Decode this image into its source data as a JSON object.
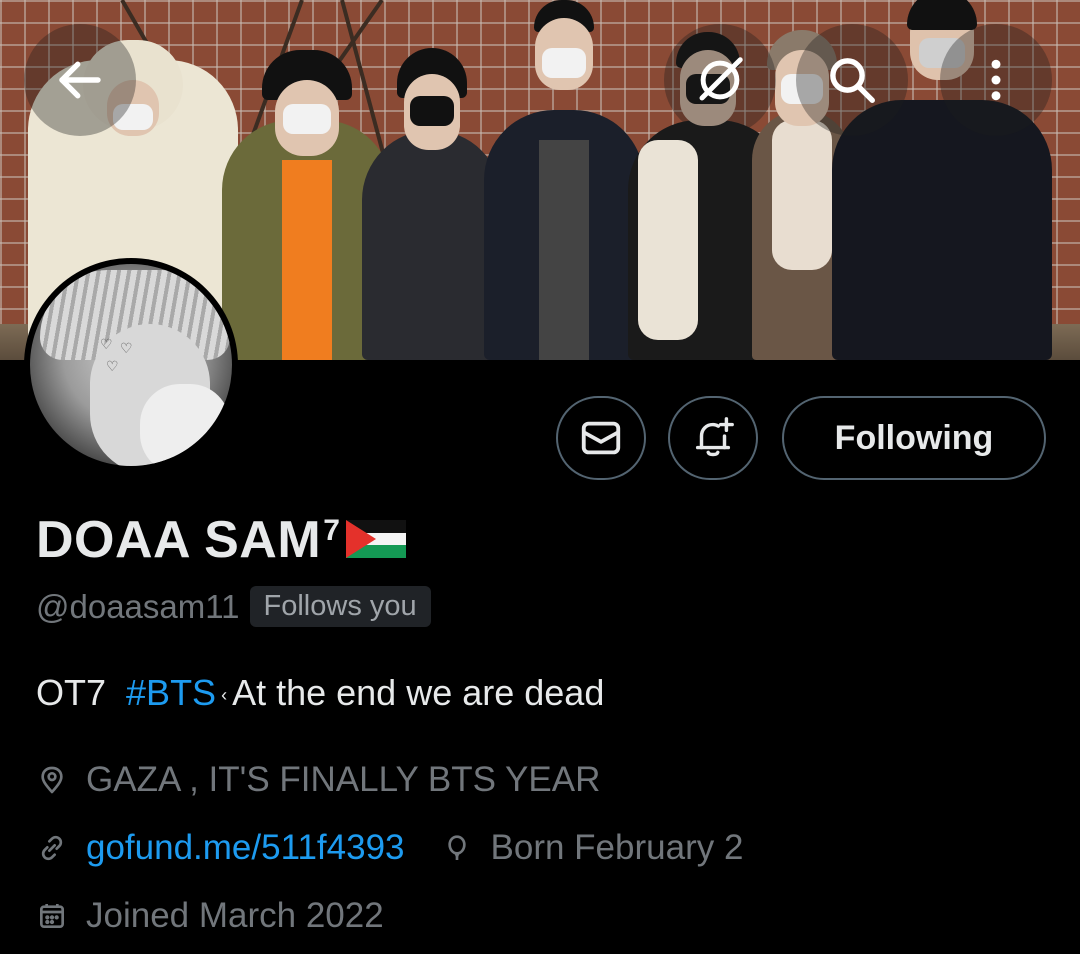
{
  "header": {
    "back_icon": "arrow-left-icon",
    "grok_icon": "grok-icon",
    "search_icon": "search-icon",
    "more_icon": "more-vertical-icon"
  },
  "actions": {
    "message_icon": "envelope-icon",
    "notify_icon": "bell-plus-icon",
    "following_label": "Following"
  },
  "profile": {
    "name": "DOAA SAM",
    "name_sup": "7",
    "handle": "@doaasam11",
    "follows_you": "Follows you",
    "bio_prefix": "OT7  ",
    "bio_hashtag": "#BTS",
    "bio_sep": " ‹ ",
    "bio_suffix": "At the end we are dead",
    "location": "GAZA , IT'S FINALLY BTS YEAR",
    "website": "gofund.me/511f4393",
    "birthday": "Born February 2",
    "joined": "Joined March 2022"
  },
  "colors": {
    "background": "#000000",
    "text": "#e7e9ea",
    "muted": "#71767b",
    "accent": "#1d9bf0",
    "border": "#536471"
  }
}
